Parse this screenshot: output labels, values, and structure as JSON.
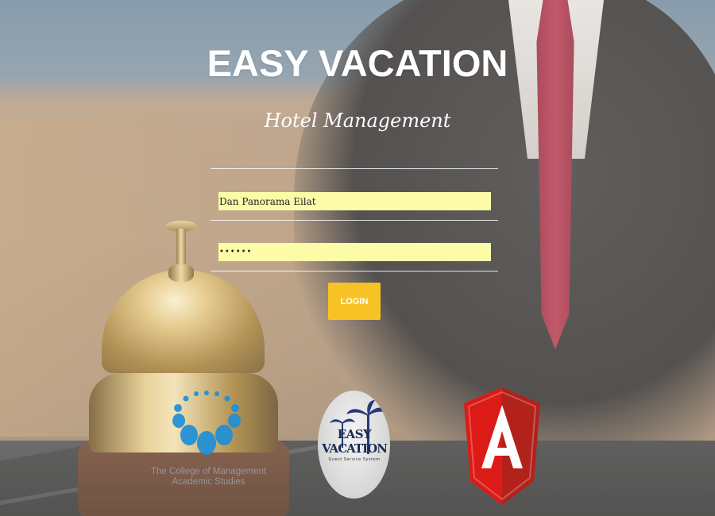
{
  "brand": {
    "title": "EASY VACATION",
    "subtitle": "Hotel Management"
  },
  "login_form": {
    "username_value": "Dan Panorama Eilat",
    "password_value": "••••••",
    "login_label": "LOGIN"
  },
  "logos": {
    "college_text_line1": "The College of Management",
    "college_text_line2": "Academic Studies",
    "easy_vacation_line1": "EASY",
    "easy_vacation_line2": "VACATION",
    "easy_vacation_tagline": "Guest Service System",
    "angular_letter": "A"
  },
  "colors": {
    "field_background": "#fbfba8",
    "login_button": "#f7c324",
    "angular_red": "#dd1b16"
  }
}
